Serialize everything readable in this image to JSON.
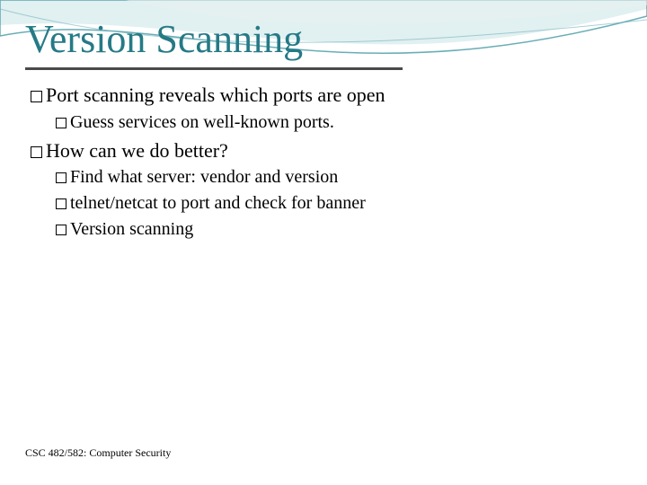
{
  "title": "Version Scanning",
  "bullets": {
    "b1": "Port scanning reveals which ports are open",
    "b1a": "Guess services on well-known ports.",
    "b2": "How can we do better?",
    "b2a": "Find what server: vendor and version",
    "b2b": "telnet/netcat to port and check for banner",
    "b2c": "Version scanning"
  },
  "footer": "CSC 482/582: Computer Security"
}
